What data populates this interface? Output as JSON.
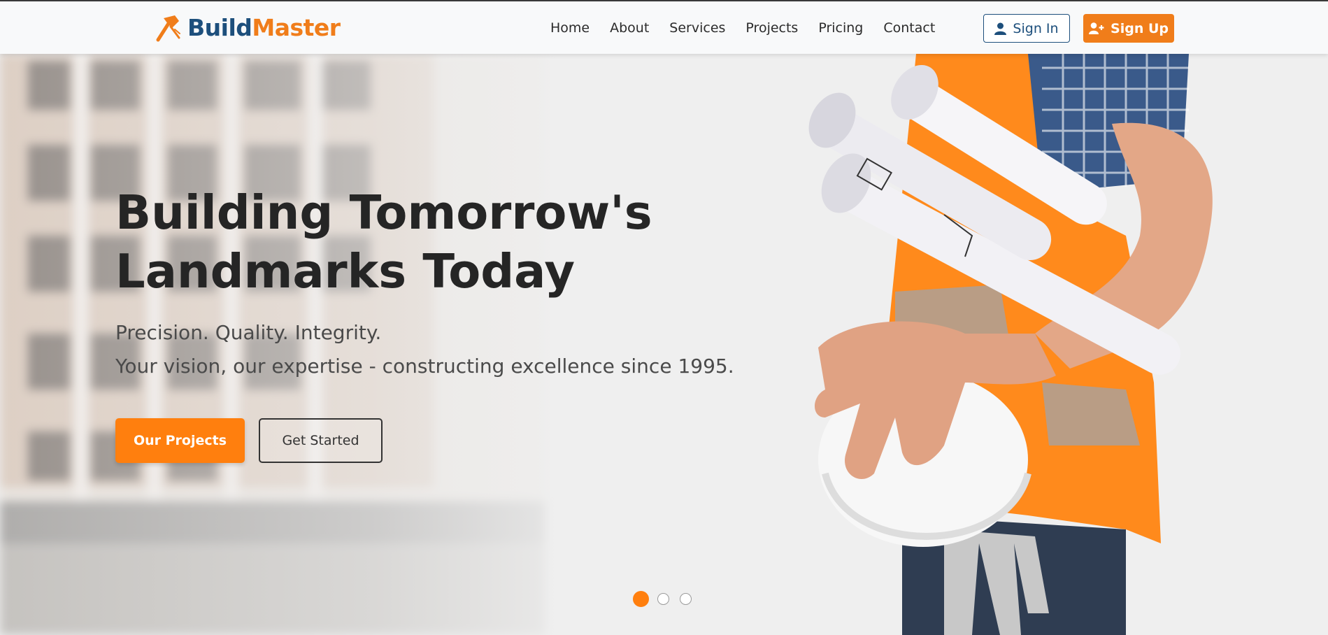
{
  "brand": {
    "name_part1": "Build",
    "name_part2": "Master",
    "logo_icon": "hammer-icon",
    "colors": {
      "primary": "#1d4f7c",
      "accent": "#f07d1a"
    }
  },
  "nav": {
    "items": [
      {
        "label": "Home"
      },
      {
        "label": "About"
      },
      {
        "label": "Services"
      },
      {
        "label": "Projects"
      },
      {
        "label": "Pricing"
      },
      {
        "label": "Contact"
      }
    ]
  },
  "auth": {
    "signin_label": "Sign In",
    "signin_icon": "user-icon",
    "signup_label": "Sign Up",
    "signup_icon": "user-plus-icon"
  },
  "hero": {
    "title_line1": "Building Tomorrow's",
    "title_line2": "Landmarks Today",
    "subtitle1": "Precision. Quality. Integrity.",
    "subtitle2": "Your vision, our expertise - constructing excellence since 1995.",
    "primary_button": "Our Projects",
    "secondary_button": "Get Started",
    "carousel": {
      "slide_count": 3,
      "active_slide": 1
    }
  }
}
